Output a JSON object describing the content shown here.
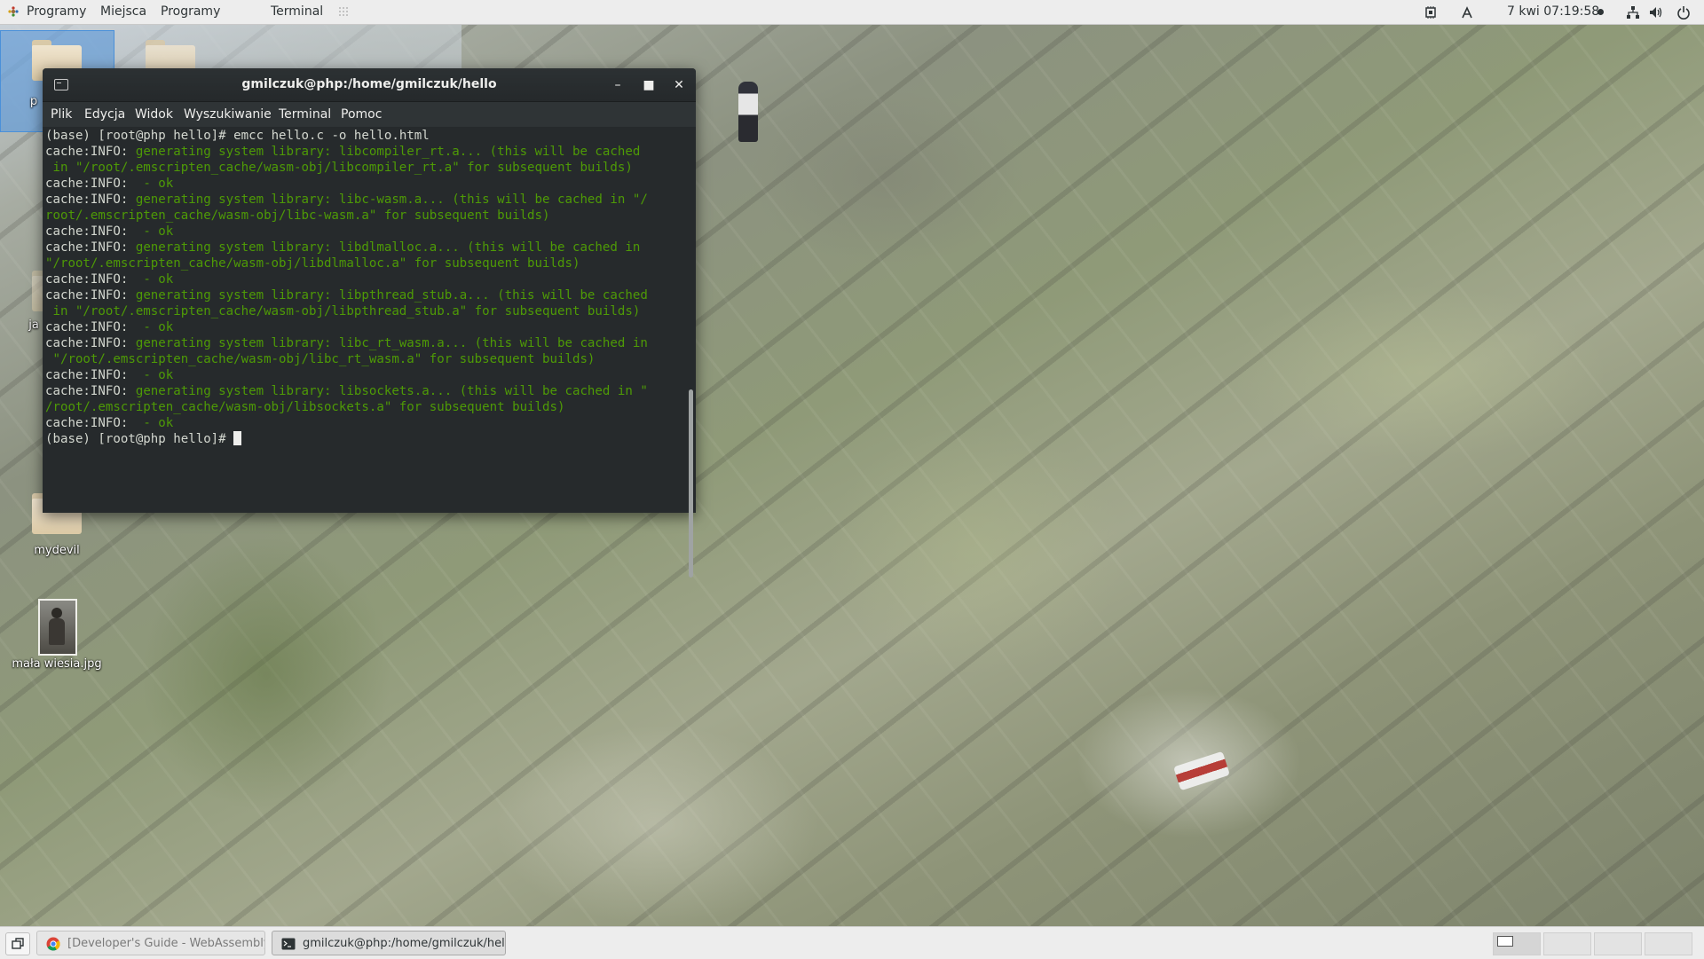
{
  "top_panel": {
    "apps_label": "Programy",
    "places_label": "Miejsca",
    "apps2_label": "Programy",
    "active_app_label": "Terminal",
    "clock": "7 kwi  07:19:58"
  },
  "desktop": {
    "icons": [
      {
        "label": "p"
      },
      {
        "label": "ja"
      },
      {
        "label": "mydevil"
      },
      {
        "label": "mała wiesia.jpg"
      }
    ]
  },
  "terminal": {
    "title": "gmilczuk@php:/home/gmilczuk/hello",
    "menu": [
      "Plik",
      "Edycja",
      "Widok",
      "Wyszukiwanie",
      "Terminal",
      "Pomoc"
    ],
    "prompt": "(base) [root@php hello]# ",
    "command": "emcc hello.c -o hello.html",
    "info_prefix": "cache:INFO: ",
    "ok_text": " - ok",
    "lines": [
      {
        "prefix": "cache:INFO: ",
        "text": "generating system library: libcompiler_rt.a... (this will be cached"
      },
      {
        "prefix": "",
        "text": " in \"/root/.emscripten_cache/wasm-obj/libcompiler_rt.a\" for subsequent builds)"
      },
      {
        "prefix": "cache:INFO: ",
        "text": " - ok"
      },
      {
        "prefix": "cache:INFO: ",
        "text": "generating system library: libc-wasm.a... (this will be cached in \"/"
      },
      {
        "prefix": "",
        "text": "root/.emscripten_cache/wasm-obj/libc-wasm.a\" for subsequent builds)"
      },
      {
        "prefix": "cache:INFO: ",
        "text": " - ok"
      },
      {
        "prefix": "cache:INFO: ",
        "text": "generating system library: libdlmalloc.a... (this will be cached in"
      },
      {
        "prefix": "",
        "text": "\"/root/.emscripten_cache/wasm-obj/libdlmalloc.a\" for subsequent builds)"
      },
      {
        "prefix": "cache:INFO: ",
        "text": " - ok"
      },
      {
        "prefix": "cache:INFO: ",
        "text": "generating system library: libpthread_stub.a... (this will be cached"
      },
      {
        "prefix": "",
        "text": " in \"/root/.emscripten_cache/wasm-obj/libpthread_stub.a\" for subsequent builds)"
      },
      {
        "prefix": "cache:INFO: ",
        "text": " - ok"
      },
      {
        "prefix": "cache:INFO: ",
        "text": "generating system library: libc_rt_wasm.a... (this will be cached in"
      },
      {
        "prefix": "",
        "text": " \"/root/.emscripten_cache/wasm-obj/libc_rt_wasm.a\" for subsequent builds)"
      },
      {
        "prefix": "cache:INFO: ",
        "text": " - ok"
      },
      {
        "prefix": "cache:INFO: ",
        "text": "generating system library: libsockets.a... (this will be cached in \""
      },
      {
        "prefix": "",
        "text": "/root/.emscripten_cache/wasm-obj/libsockets.a\" for subsequent builds)"
      },
      {
        "prefix": "cache:INFO: ",
        "text": " - ok"
      }
    ]
  },
  "taskbar": {
    "tasks": [
      {
        "label": "[Developer's Guide - WebAssembly -..."
      },
      {
        "label": "gmilczuk@php:/home/gmilczuk/hello"
      }
    ]
  },
  "colors": {
    "terminal_bg": "#262a2c",
    "terminal_green": "#4e9a06",
    "panel_bg": "#ededed"
  }
}
